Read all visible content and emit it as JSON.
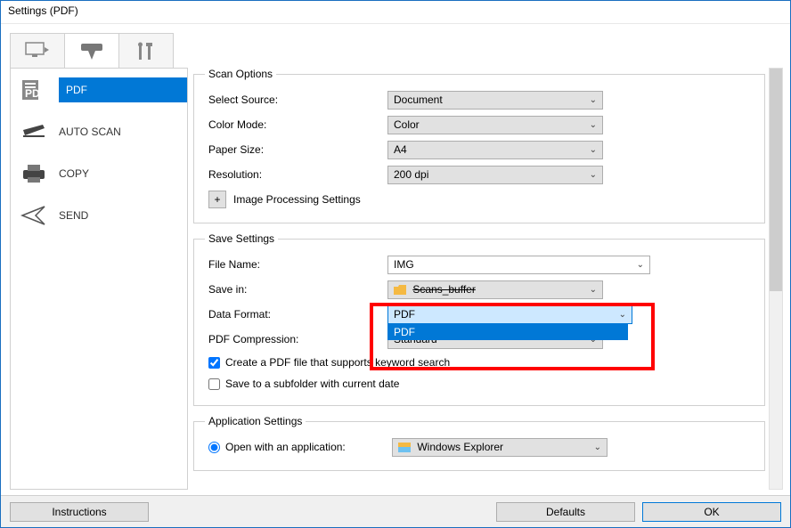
{
  "window": {
    "title": "Settings (PDF)"
  },
  "sidebar": {
    "items": [
      {
        "label": "PDF"
      },
      {
        "label": "AUTO SCAN"
      },
      {
        "label": "COPY"
      },
      {
        "label": "SEND"
      }
    ]
  },
  "scanOptions": {
    "legend": "Scan Options",
    "selectSourceLabel": "Select Source:",
    "selectSourceValue": "Document",
    "colorModeLabel": "Color Mode:",
    "colorModeValue": "Color",
    "paperSizeLabel": "Paper Size:",
    "paperSizeValue": "A4",
    "resolutionLabel": "Resolution:",
    "resolutionValue": "200 dpi",
    "imageProcessingLabel": "Image Processing Settings"
  },
  "saveSettings": {
    "legend": "Save Settings",
    "fileNameLabel": "File Name:",
    "fileNameValue": "IMG",
    "saveInLabel": "Save in:",
    "saveInValue": "Scans_buffer",
    "dataFormatLabel": "Data Format:",
    "dataFormatValue": "PDF",
    "dataFormatOption": "PDF",
    "pdfCompressionLabel": "PDF Compression:",
    "pdfCompressionValue": "Standard",
    "checkboxKeyword": "Create a PDF file that supports keyword search",
    "checkboxSubfolder": "Save to a subfolder with current date"
  },
  "appSettings": {
    "legend": "Application Settings",
    "openWithLabel": "Open with an application:",
    "openWithValue": "Windows Explorer"
  },
  "footer": {
    "instructions": "Instructions",
    "defaults": "Defaults",
    "ok": "OK"
  }
}
